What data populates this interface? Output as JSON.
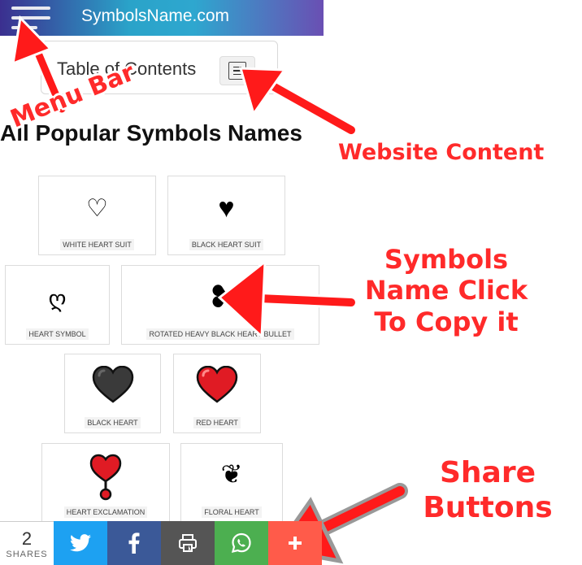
{
  "header": {
    "site_title": "SymbolsName.com",
    "menu_icon": "hamburger-menu-icon"
  },
  "toc": {
    "label": "Table of Contents",
    "toggle_icon": "list-toggle-icon"
  },
  "heading": "All Popular Symbols Names",
  "cards": [
    {
      "symbol": "♡",
      "label": "WHITE HEART SUIT"
    },
    {
      "symbol": "♥",
      "label": "BLACK HEART SUIT"
    },
    {
      "symbol": "ღ",
      "label": "HEART SYMBOL"
    },
    {
      "symbol": "❥",
      "label": "ROTATED HEAVY BLACK HEART BULLET"
    },
    {
      "symbol": "🖤",
      "label": "BLACK HEART"
    },
    {
      "symbol": "❤️",
      "label": "RED HEART"
    },
    {
      "symbol": "❣️",
      "label": "HEART EXCLAMATION"
    },
    {
      "symbol": "❦",
      "label": "FLORAL HEART"
    }
  ],
  "annotations": {
    "menu_bar": "Menu Bar",
    "website_content": "Website Content",
    "symbols_click_line1": "Symbols",
    "symbols_click_line2": "Name Click",
    "symbols_click_line3": "To Copy it",
    "share_line1": "Share",
    "share_line2": "Buttons"
  },
  "share": {
    "count": "2",
    "count_label": "SHARES",
    "buttons": [
      {
        "name": "twitter",
        "icon": "twitter-bird-icon",
        "color": "#1da1f2"
      },
      {
        "name": "facebook",
        "icon": "facebook-f-icon",
        "color": "#3b5998"
      },
      {
        "name": "print",
        "icon": "printer-icon",
        "color": "#555555"
      },
      {
        "name": "whatsapp",
        "icon": "whatsapp-icon",
        "color": "#4caf50"
      },
      {
        "name": "more",
        "icon": "plus-icon",
        "color": "#ff5b4a"
      }
    ]
  },
  "colors": {
    "annotation": "#ff2a2a",
    "header_gradient_start": "#3b2f8f",
    "header_gradient_mid": "#2aa3c9",
    "header_gradient_end": "#6a4fb3"
  }
}
